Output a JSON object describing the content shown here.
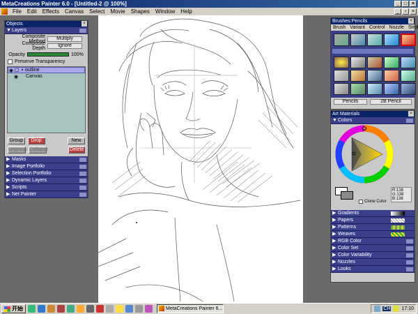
{
  "window": {
    "title": "MetaCreations Painter 6.0 - [Untitled-2 @ 100%]"
  },
  "menu": [
    "File",
    "Edit",
    "Effects",
    "Canvas",
    "Select",
    "Movie",
    "Shapes",
    "Window",
    "Help"
  ],
  "objects": {
    "title": "Objects",
    "layers_label": "Layers",
    "composite_method_label": "Composite Method",
    "composite_method_value": "Multiply",
    "composite_depth_label": "Composite Depth",
    "composite_depth_value": "Ignore",
    "opacity_label": "Opacity",
    "opacity_value": "100%",
    "opacity_fraction": 1.0,
    "preserve_label": "Preserve Transparency",
    "layer_items": [
      "outline",
      "Canvas"
    ],
    "buttons": {
      "group": "Group",
      "drop": "Drop",
      "new": "New",
      "ungroup": "Ungroup",
      "collapse": "Collapse",
      "delete": "Delete"
    },
    "sections": [
      "Masks",
      "Image Portfolio",
      "Selection Portfolio",
      "Dynamic Layers",
      "Scripts",
      "Net Painter"
    ]
  },
  "brushes": {
    "title": "Brushes:Pencils",
    "menu": [
      "Brush",
      "Variant",
      "Control",
      "Nozzle",
      "Stroke"
    ],
    "brush_name": "Pencils",
    "variant_name": "2B Pencil"
  },
  "art_materials": {
    "title": "Art Materials",
    "colors_label": "Colors",
    "rgb_r": "R:138",
    "rgb_g": "G:138",
    "rgb_b": "B:138",
    "clone_color_label": "Clone Color",
    "sections": [
      "Gradients",
      "Papers",
      "Patterns",
      "Weaves",
      "RGB Color",
      "Color Set",
      "Color Variability",
      "Nozzles",
      "Looks"
    ]
  },
  "taskbar": {
    "start_label": "开始",
    "task_label": "MetaCreations Painter 6....",
    "tray_lang": "CH",
    "clock": "17:10"
  },
  "colors": {
    "title_blue": "#0a246a",
    "section_blue": "#3a3f8c",
    "selected_layer": "#a8a8e8",
    "layers_bg": "#a9c4c0"
  }
}
